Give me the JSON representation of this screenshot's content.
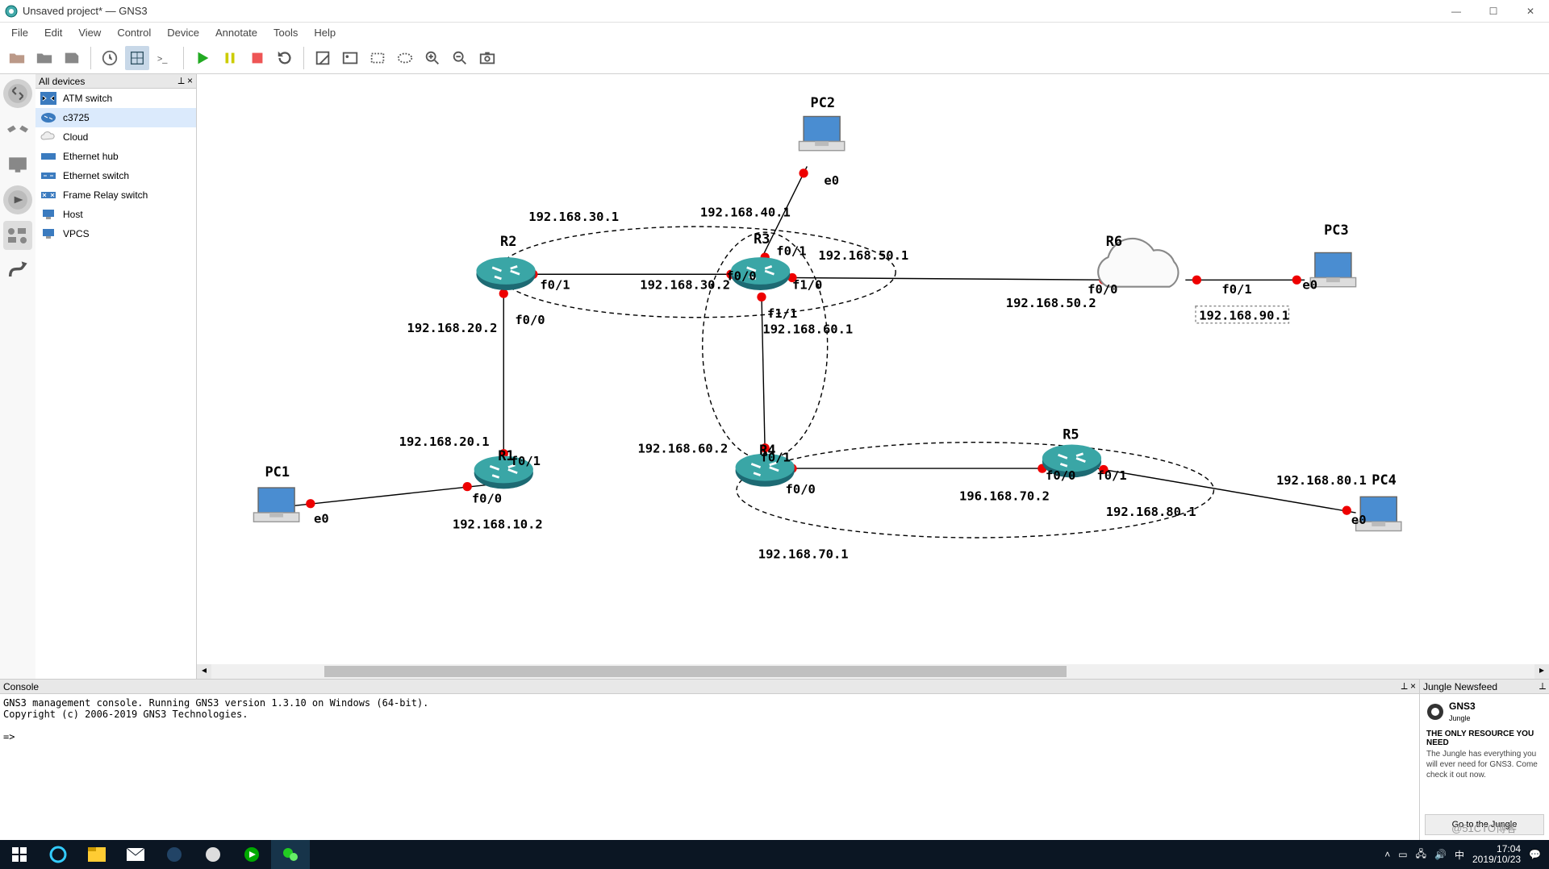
{
  "window": {
    "title": "Unsaved project* — GNS3"
  },
  "menu": [
    "File",
    "Edit",
    "View",
    "Control",
    "Device",
    "Annotate",
    "Tools",
    "Help"
  ],
  "sidepanel": {
    "title": "All devices",
    "controls": "⟂ ×",
    "items": [
      "ATM switch",
      "c3725",
      "Cloud",
      "Ethernet hub",
      "Ethernet switch",
      "Frame Relay switch",
      "Host",
      "VPCS"
    ],
    "selected": 1
  },
  "topology": {
    "nodes": {
      "PC1": {
        "label": "PC1"
      },
      "PC2": {
        "label": "PC2"
      },
      "PC3": {
        "label": "PC3"
      },
      "PC4": {
        "label": "PC4"
      },
      "R1": {
        "label": "R1"
      },
      "R2": {
        "label": "R2"
      },
      "R3": {
        "label": "R3"
      },
      "R4": {
        "label": "R4"
      },
      "R5": {
        "label": "R5"
      },
      "R6": {
        "label": "R6"
      }
    },
    "ports": {
      "pc1_e0": "e0",
      "pc2_e0": "e0",
      "pc3_e0": "e0",
      "pc4_e0": "e0",
      "r1_f00": "f0/0",
      "r1_f01": "f0/1",
      "r2_f00": "f0/0",
      "r2_f01": "f0/1",
      "r3_f00": "f0/0",
      "r3_f01": "f0/1",
      "r3_f10": "f1/0",
      "r3_f11": "f1/1",
      "r4_f00": "f0/0",
      "r4_f01": "f0/1",
      "r5_f00": "f0/0",
      "r5_f01": "f0/1",
      "r6_f00": "f0/0",
      "r6_f01": "f0/1"
    },
    "ips": {
      "a": "192.168.30.1",
      "b": "192.168.40.1",
      "c": "192.168.50.1",
      "d": "192.168.50.2",
      "e": "192.168.20.2",
      "f": "192.168.30.2",
      "g": "192.168.60.1",
      "h": "192.168.20.1",
      "i": "192.168.60.2",
      "j": "192.168.10.2",
      "k": "196.168.70.2",
      "l": "192.168.80.1",
      "m": "192.168.80.1",
      "n": "192.168.90.1",
      "o": "192.168.70.1"
    }
  },
  "console": {
    "title": "Console",
    "controls": "⟂ ×",
    "lines": "GNS3 management console. Running GNS3 version 1.3.10 on Windows (64-bit).\nCopyright (c) 2006-2019 GNS3 Technologies.\n\n=>"
  },
  "news": {
    "title": "Jungle Newsfeed",
    "controls": "⟂",
    "brand": "GNS3",
    "brand_sub": "Jungle",
    "headline": "THE ONLY RESOURCE YOU NEED",
    "text": "The Jungle has everything you will ever need for GNS3. Come check it out now.",
    "button": "Go to the Jungle"
  },
  "taskbar": {
    "ime": "中",
    "time": "17:04",
    "date": "2019/10/23"
  },
  "watermark": "@51CTO博客"
}
